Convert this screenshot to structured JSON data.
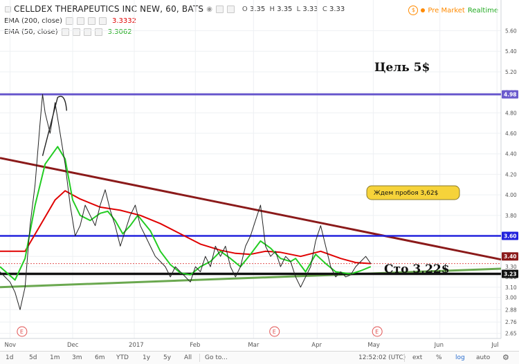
{
  "header": {
    "title": "CELLDEX THERAPEUTICS INC NEW, 60, BATS",
    "ohlc": {
      "o_label": "O",
      "o": "3.35",
      "h_label": "H",
      "h": "3.35",
      "l_label": "L",
      "l": "3.33",
      "c_label": "C",
      "c": "3.33"
    },
    "ema200_label": "EMA (200, close)",
    "ema200_value": "3.3332",
    "ema50_label": "EMA (50, close)",
    "ema50_value": "3.3062",
    "premarket_label": "Pre Market",
    "realtime_label": "Realtime",
    "colors": {
      "ema200": "#e00000",
      "ema50": "#22cc22",
      "premarket": "#ff8a00",
      "realtime": "#22aa22"
    }
  },
  "annotations": {
    "target": "Цель 5$",
    "stop": "Сто 3,22$",
    "callout": "Ждем пробоя 3,62$",
    "earnings_marker": "E"
  },
  "bottom": {
    "ranges": [
      "1d",
      "5d",
      "1m",
      "3m",
      "6m",
      "YTD",
      "1y",
      "5y",
      "All"
    ],
    "goto": "Go to...",
    "time": "12:52:02 (UTC)",
    "ext": "ext",
    "percent": "%",
    "log": "log",
    "auto": "auto"
  },
  "chart_data": {
    "type": "line",
    "ylim": [
      2.6,
      5.9
    ],
    "y_ticks": [
      5.6,
      5.4,
      5.2,
      5.0,
      4.8,
      4.6,
      4.4,
      4.2,
      4.0,
      3.8,
      3.6,
      3.4,
      3.3,
      3.2,
      3.1,
      3.0,
      2.88,
      2.76,
      2.65
    ],
    "x_labels": [
      {
        "label": "Nov",
        "pos": 0.02
      },
      {
        "label": "Dec",
        "pos": 0.145
      },
      {
        "label": "2017",
        "pos": 0.268
      },
      {
        "label": "Feb",
        "pos": 0.39
      },
      {
        "label": "Mar",
        "pos": 0.506
      },
      {
        "label": "Apr",
        "pos": 0.633
      },
      {
        "label": "May",
        "pos": 0.745
      },
      {
        "label": "Jun",
        "pos": 0.878
      },
      {
        "label": "Jul",
        "pos": 0.992
      }
    ],
    "price_badges": [
      {
        "value": "4.98",
        "color": "#6a5acd"
      },
      {
        "value": "3.60",
        "color": "#2222dd"
      },
      {
        "value": "3.40",
        "color": "#8b1a1a"
      },
      {
        "value": "3.23",
        "color": "#111111"
      }
    ],
    "levels": {
      "target_line": 4.98,
      "resistance_line": 3.6,
      "stop_line": 3.23,
      "current_price": 3.33
    },
    "trendlines": [
      {
        "name": "",
        "from": [
          0.0,
          4.36
        ],
        "to": [
          1.0,
          3.37
        ],
        "color": "#8b1a1a"
      },
      {
        "name": "",
        "from": [
          0.0,
          3.1
        ],
        "to": [
          1.0,
          3.28
        ],
        "color": "#6aa84f"
      }
    ],
    "series": [
      {
        "name": "",
        "color": "#e00000",
        "points": [
          [
            0.0,
            3.45
          ],
          [
            0.05,
            3.45
          ],
          [
            0.08,
            3.7
          ],
          [
            0.11,
            3.95
          ],
          [
            0.13,
            4.04
          ],
          [
            0.16,
            3.96
          ],
          [
            0.2,
            3.88
          ],
          [
            0.24,
            3.85
          ],
          [
            0.28,
            3.8
          ],
          [
            0.32,
            3.72
          ],
          [
            0.36,
            3.62
          ],
          [
            0.4,
            3.52
          ],
          [
            0.44,
            3.46
          ],
          [
            0.47,
            3.43
          ],
          [
            0.5,
            3.42
          ],
          [
            0.53,
            3.45
          ],
          [
            0.56,
            3.44
          ],
          [
            0.6,
            3.4
          ],
          [
            0.64,
            3.45
          ],
          [
            0.68,
            3.38
          ],
          [
            0.71,
            3.34
          ],
          [
            0.74,
            3.33
          ]
        ]
      },
      {
        "name": "",
        "color": "#22cc22",
        "points": [
          [
            0.0,
            3.3
          ],
          [
            0.03,
            3.17
          ],
          [
            0.05,
            3.38
          ],
          [
            0.07,
            3.9
          ],
          [
            0.09,
            4.3
          ],
          [
            0.115,
            4.47
          ],
          [
            0.13,
            4.35
          ],
          [
            0.145,
            3.95
          ],
          [
            0.16,
            3.8
          ],
          [
            0.18,
            3.75
          ],
          [
            0.2,
            3.82
          ],
          [
            0.215,
            3.84
          ],
          [
            0.23,
            3.75
          ],
          [
            0.245,
            3.62
          ],
          [
            0.26,
            3.7
          ],
          [
            0.275,
            3.8
          ],
          [
            0.3,
            3.65
          ],
          [
            0.32,
            3.45
          ],
          [
            0.34,
            3.32
          ],
          [
            0.36,
            3.24
          ],
          [
            0.38,
            3.22
          ],
          [
            0.4,
            3.3
          ],
          [
            0.42,
            3.35
          ],
          [
            0.44,
            3.45
          ],
          [
            0.46,
            3.38
          ],
          [
            0.48,
            3.3
          ],
          [
            0.5,
            3.42
          ],
          [
            0.52,
            3.55
          ],
          [
            0.54,
            3.48
          ],
          [
            0.56,
            3.38
          ],
          [
            0.58,
            3.35
          ],
          [
            0.59,
            3.38
          ],
          [
            0.61,
            3.25
          ],
          [
            0.63,
            3.42
          ],
          [
            0.65,
            3.33
          ],
          [
            0.67,
            3.25
          ],
          [
            0.7,
            3.23
          ],
          [
            0.72,
            3.26
          ],
          [
            0.74,
            3.3
          ]
        ]
      },
      {
        "name": "",
        "color": "#222222",
        "points": [
          [
            0.0,
            3.25
          ],
          [
            0.01,
            3.2
          ],
          [
            0.02,
            3.15
          ],
          [
            0.03,
            3.05
          ],
          [
            0.04,
            2.88
          ],
          [
            0.05,
            3.1
          ],
          [
            0.06,
            3.7
          ],
          [
            0.07,
            4.1
          ],
          [
            0.08,
            4.7
          ],
          [
            0.085,
            4.98
          ],
          [
            0.09,
            4.8
          ],
          [
            0.1,
            4.6
          ],
          [
            0.11,
            4.9
          ],
          [
            0.12,
            4.6
          ],
          [
            0.13,
            4.3
          ],
          [
            0.14,
            3.9
          ],
          [
            0.15,
            3.6
          ],
          [
            0.16,
            3.7
          ],
          [
            0.17,
            3.9
          ],
          [
            0.18,
            3.8
          ],
          [
            0.19,
            3.7
          ],
          [
            0.2,
            3.9
          ],
          [
            0.21,
            4.05
          ],
          [
            0.22,
            3.85
          ],
          [
            0.23,
            3.7
          ],
          [
            0.24,
            3.5
          ],
          [
            0.25,
            3.65
          ],
          [
            0.26,
            3.8
          ],
          [
            0.27,
            3.9
          ],
          [
            0.28,
            3.7
          ],
          [
            0.29,
            3.6
          ],
          [
            0.3,
            3.5
          ],
          [
            0.31,
            3.4
          ],
          [
            0.32,
            3.35
          ],
          [
            0.33,
            3.3
          ],
          [
            0.34,
            3.2
          ],
          [
            0.35,
            3.3
          ],
          [
            0.36,
            3.25
          ],
          [
            0.37,
            3.2
          ],
          [
            0.38,
            3.15
          ],
          [
            0.39,
            3.3
          ],
          [
            0.4,
            3.25
          ],
          [
            0.41,
            3.4
          ],
          [
            0.42,
            3.3
          ],
          [
            0.43,
            3.5
          ],
          [
            0.44,
            3.4
          ],
          [
            0.45,
            3.5
          ],
          [
            0.46,
            3.3
          ],
          [
            0.47,
            3.2
          ],
          [
            0.48,
            3.3
          ],
          [
            0.49,
            3.5
          ],
          [
            0.5,
            3.6
          ],
          [
            0.51,
            3.75
          ],
          [
            0.52,
            3.9
          ],
          [
            0.525,
            3.7
          ],
          [
            0.53,
            3.5
          ],
          [
            0.54,
            3.4
          ],
          [
            0.55,
            3.45
          ],
          [
            0.56,
            3.3
          ],
          [
            0.57,
            3.4
          ],
          [
            0.58,
            3.35
          ],
          [
            0.59,
            3.2
          ],
          [
            0.6,
            3.1
          ],
          [
            0.61,
            3.2
          ],
          [
            0.62,
            3.3
          ],
          [
            0.63,
            3.55
          ],
          [
            0.64,
            3.7
          ],
          [
            0.65,
            3.5
          ],
          [
            0.66,
            3.3
          ],
          [
            0.67,
            3.2
          ],
          [
            0.68,
            3.25
          ],
          [
            0.69,
            3.2
          ],
          [
            0.7,
            3.22
          ],
          [
            0.71,
            3.3
          ],
          [
            0.72,
            3.35
          ],
          [
            0.73,
            3.4
          ],
          [
            0.74,
            3.33
          ]
        ]
      }
    ]
  }
}
